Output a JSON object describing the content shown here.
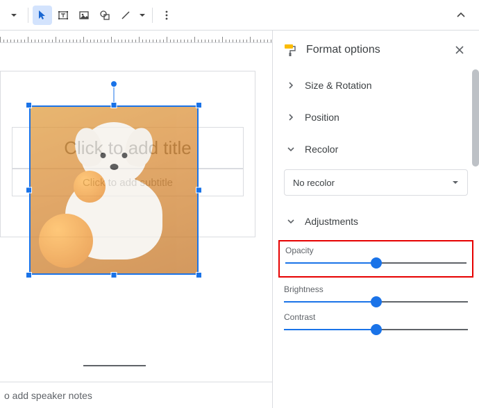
{
  "toolbar": {
    "buttons": [
      {
        "name": "more-dropdown",
        "icon": "caret-down"
      },
      {
        "name": "select-tool",
        "icon": "cursor",
        "active": true
      },
      {
        "name": "textbox-tool",
        "icon": "textbox"
      },
      {
        "name": "image-tool",
        "icon": "image"
      },
      {
        "name": "shape-tool",
        "icon": "shape"
      },
      {
        "name": "line-tool",
        "icon": "line"
      },
      {
        "name": "line-dropdown",
        "icon": "caret-down"
      },
      {
        "name": "more-tools",
        "icon": "more-vert"
      }
    ]
  },
  "slide": {
    "title_placeholder": "Click to add title",
    "subtitle_placeholder": "Click to add subtitle"
  },
  "notes": {
    "placeholder": "o add speaker notes"
  },
  "panel": {
    "title": "Format options",
    "sections": {
      "size_rotation": "Size & Rotation",
      "position": "Position",
      "recolor": "Recolor",
      "adjustments": "Adjustments"
    },
    "recolor_value": "No recolor",
    "sliders": {
      "opacity": {
        "label": "Opacity",
        "percent": 50
      },
      "brightness": {
        "label": "Brightness",
        "percent": 50
      },
      "contrast": {
        "label": "Contrast",
        "percent": 50
      }
    }
  }
}
